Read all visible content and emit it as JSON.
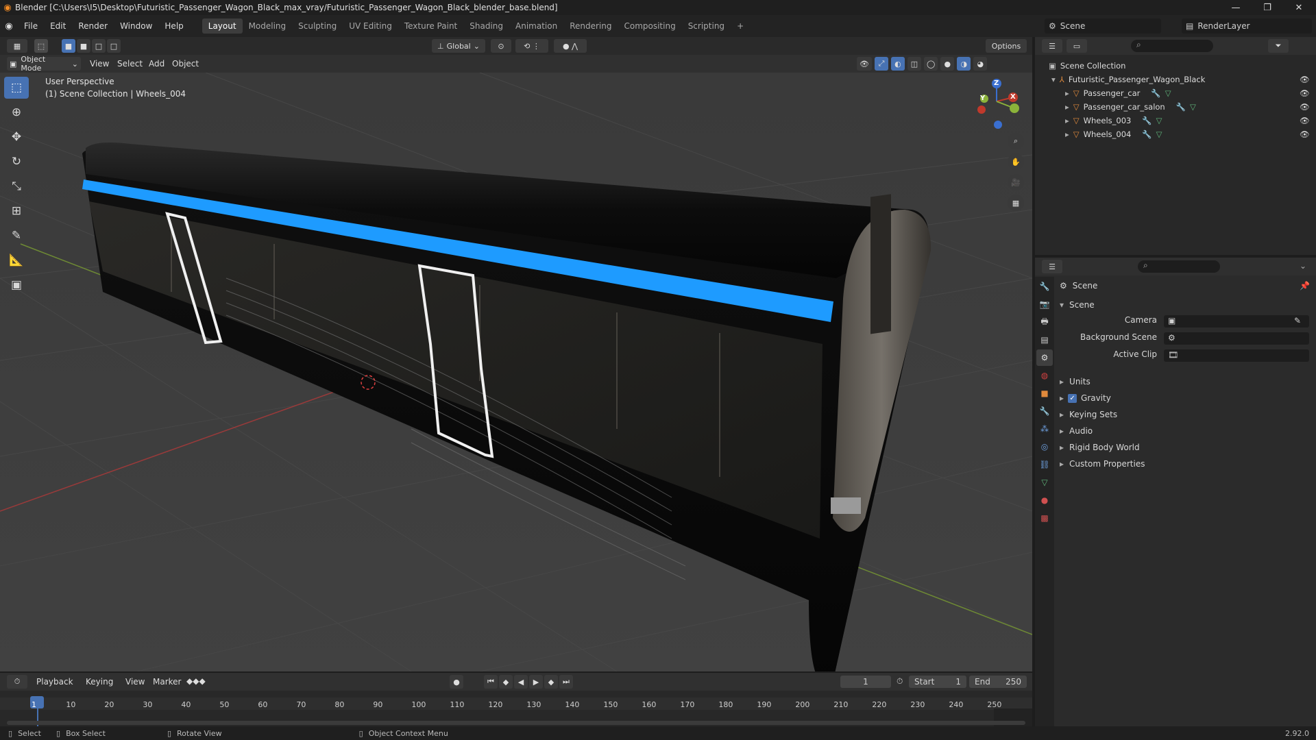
{
  "window": {
    "title": "Blender [C:\\Users\\I5\\Desktop\\Futuristic_Passenger_Wagon_Black_max_vray/Futuristic_Passenger_Wagon_Black_blender_base.blend]",
    "minimize": "—",
    "maximize": "❐",
    "close": "✕"
  },
  "menu": [
    "File",
    "Edit",
    "Render",
    "Window",
    "Help"
  ],
  "workspaces": [
    "Layout",
    "Modeling",
    "Sculpting",
    "UV Editing",
    "Texture Paint",
    "Shading",
    "Animation",
    "Rendering",
    "Compositing",
    "Scripting"
  ],
  "workspace_add": "+",
  "scene": {
    "label": "Scene",
    "renderlayer": "RenderLayer"
  },
  "vp_top": {
    "orientation": "Global",
    "options": "Options"
  },
  "vp_header": {
    "mode": "Object Mode",
    "menus": [
      "View",
      "Select",
      "Add",
      "Object"
    ]
  },
  "viewport": {
    "perspective": "User Perspective",
    "collection_info": "(1) Scene Collection | Wheels_004"
  },
  "gizmo": {
    "x": "X",
    "y": "Y",
    "z": "Z"
  },
  "outliner": {
    "root": "Scene Collection",
    "collection": "Futuristic_Passenger_Wagon_Black",
    "objects": [
      "Passenger_car",
      "Passenger_car_salon",
      "Wheels_003",
      "Wheels_004"
    ]
  },
  "properties": {
    "header": "Scene",
    "panel": "Scene",
    "camera_label": "Camera",
    "bg_scene_label": "Background Scene",
    "active_clip_label": "Active Clip",
    "sections": [
      "Units",
      "Gravity",
      "Keying Sets",
      "Audio",
      "Rigid Body World",
      "Custom Properties"
    ]
  },
  "timeline": {
    "menus": [
      "Playback",
      "Keying",
      "View",
      "Marker"
    ],
    "current_frame": "1",
    "start_label": "Start",
    "start": "1",
    "end_label": "End",
    "end": "250",
    "ticks": [
      "1",
      "10",
      "20",
      "30",
      "40",
      "50",
      "60",
      "70",
      "80",
      "90",
      "100",
      "110",
      "120",
      "130",
      "140",
      "150",
      "160",
      "170",
      "180",
      "190",
      "200",
      "210",
      "220",
      "230",
      "240",
      "250"
    ]
  },
  "status": {
    "select": "Select",
    "box_select": "Box Select",
    "rotate": "Rotate View",
    "context": "Object Context Menu",
    "version": "2.92.0"
  },
  "colors": {
    "accent": "#4772b3",
    "stripe": "#1e9bff",
    "x_axis": "#c0392b",
    "y_axis": "#8bb33a",
    "orange": "#e08a3c"
  }
}
